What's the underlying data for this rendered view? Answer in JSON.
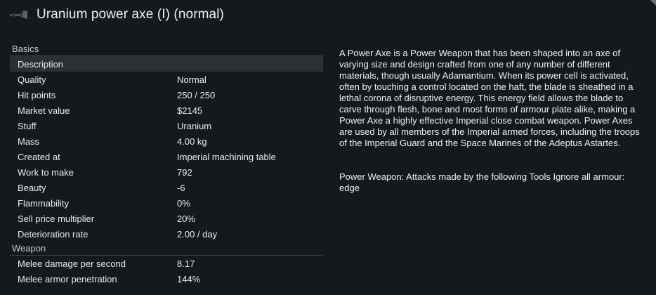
{
  "window": {
    "title": "Uranium power axe (I) (normal)",
    "icon": "axe-icon"
  },
  "sections": [
    {
      "header": "Basics",
      "rows": [
        {
          "label": "Description",
          "value": ""
        },
        {
          "label": "Quality",
          "value": "Normal"
        },
        {
          "label": "Hit points",
          "value": "250 / 250"
        },
        {
          "label": "Market value",
          "value": "$2145"
        },
        {
          "label": "Stuff",
          "value": "Uranium"
        },
        {
          "label": "Mass",
          "value": "4.00 kg"
        },
        {
          "label": "Created at",
          "value": "Imperial machining table"
        },
        {
          "label": "Work to make",
          "value": "792"
        },
        {
          "label": "Beauty",
          "value": "-6"
        },
        {
          "label": "Flammability",
          "value": "0%"
        },
        {
          "label": "Sell price multiplier",
          "value": "20%"
        },
        {
          "label": "Deterioration rate",
          "value": "2.00 / day"
        }
      ]
    },
    {
      "header": "Weapon",
      "rows": [
        {
          "label": "Melee damage per second",
          "value": "8.17"
        },
        {
          "label": "Melee armor penetration",
          "value": "144%"
        }
      ]
    }
  ],
  "description": {
    "text": "A Power Axe is a Power Weapon that has been shaped into an axe of varying size and design crafted from one of any number of different materials, though usually Adamantium. When its power cell is activated, often by touching a control located on the haft, the blade is sheathed in a lethal corona of disruptive energy. This energy field allows the blade to carve through flesh, bone and most forms of armour plate alike, making a Power Axe a highly effective Imperial close combat weapon. Power Axes are used by all members of the Imperial armed forces, including the troops of the Imperial Guard and the Space Marines of the Adeptus Astartes.",
    "note_line1": " Power Weapon: Attacks made by the following Tools Ignore all armour:",
    "note_line2": "edge"
  },
  "colors": {
    "background": "#16191c",
    "selected_row": "#2b3035",
    "divider": "#3c4146"
  }
}
